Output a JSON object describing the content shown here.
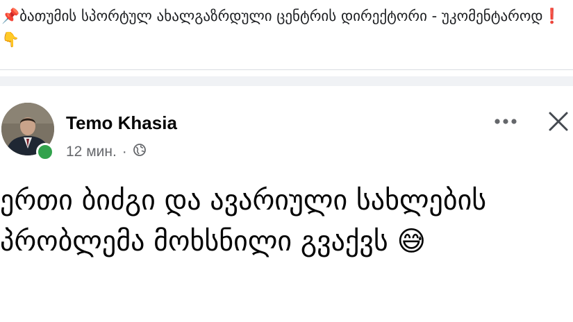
{
  "caption": {
    "text": "📌ბათუმის სპორტულ ახალგაზრდული ცენტრის დირექტორი - უკომენტაროდ❗️👇"
  },
  "post": {
    "author": "Temo Khasia",
    "time": "12 мин.",
    "separator": "·",
    "privacy_icon": "globe-icon",
    "text": "ერთი ბიძგი და ავარიული სახლების პრობლემა მოხსნილი გვაქვს 😅"
  },
  "colors": {
    "online": "#31a24c",
    "meta": "#65676b",
    "text": "#050505"
  }
}
